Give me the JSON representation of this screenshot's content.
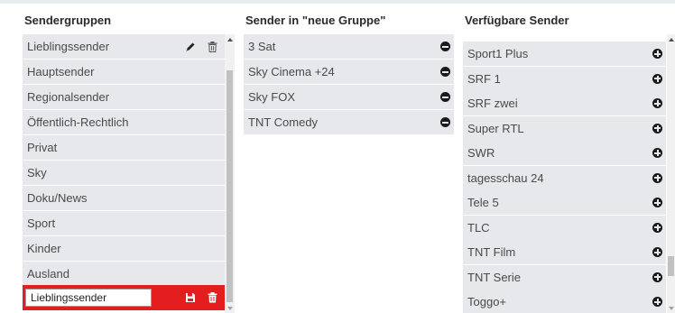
{
  "columns": {
    "groups": {
      "title": "Sendergruppen"
    },
    "group_channels": {
      "title": "Sender in \"neue Gruppe\""
    },
    "available": {
      "title": "Verfügbare Sender"
    }
  },
  "groups": [
    {
      "label": "Lieblingssender"
    },
    {
      "label": "Hauptsender"
    },
    {
      "label": "Regionalsender"
    },
    {
      "label": "Öffentlich-Rechtlich"
    },
    {
      "label": "Privat"
    },
    {
      "label": "Sky"
    },
    {
      "label": "Doku/News"
    },
    {
      "label": "Sport"
    },
    {
      "label": "Kinder"
    },
    {
      "label": "Ausland"
    }
  ],
  "new_group_input": {
    "value": "Lieblingssender"
  },
  "group_channels": [
    {
      "label": "3 Sat"
    },
    {
      "label": "Sky Cinema +24"
    },
    {
      "label": "Sky FOX"
    },
    {
      "label": "TNT Comedy"
    }
  ],
  "available_channels": [
    {
      "label": "Sport1 Plus"
    },
    {
      "label": "SRF 1"
    },
    {
      "label": "SRF zwei"
    },
    {
      "label": "Super RTL"
    },
    {
      "label": "SWR"
    },
    {
      "label": "tagesschau 24"
    },
    {
      "label": "Tele 5"
    },
    {
      "label": "TLC"
    },
    {
      "label": "TNT Film"
    },
    {
      "label": "TNT Serie"
    },
    {
      "label": "Toggo+"
    }
  ],
  "icons": {
    "edit": "pencil-icon",
    "delete": "trash-icon",
    "save": "floppy-disk-icon",
    "remove": "minus-circle-icon",
    "add": "plus-circle-icon"
  },
  "colors": {
    "accent_red": "#e41e1e",
    "row_bg": "#e6e8eb",
    "page_bg": "#e9ecef"
  }
}
